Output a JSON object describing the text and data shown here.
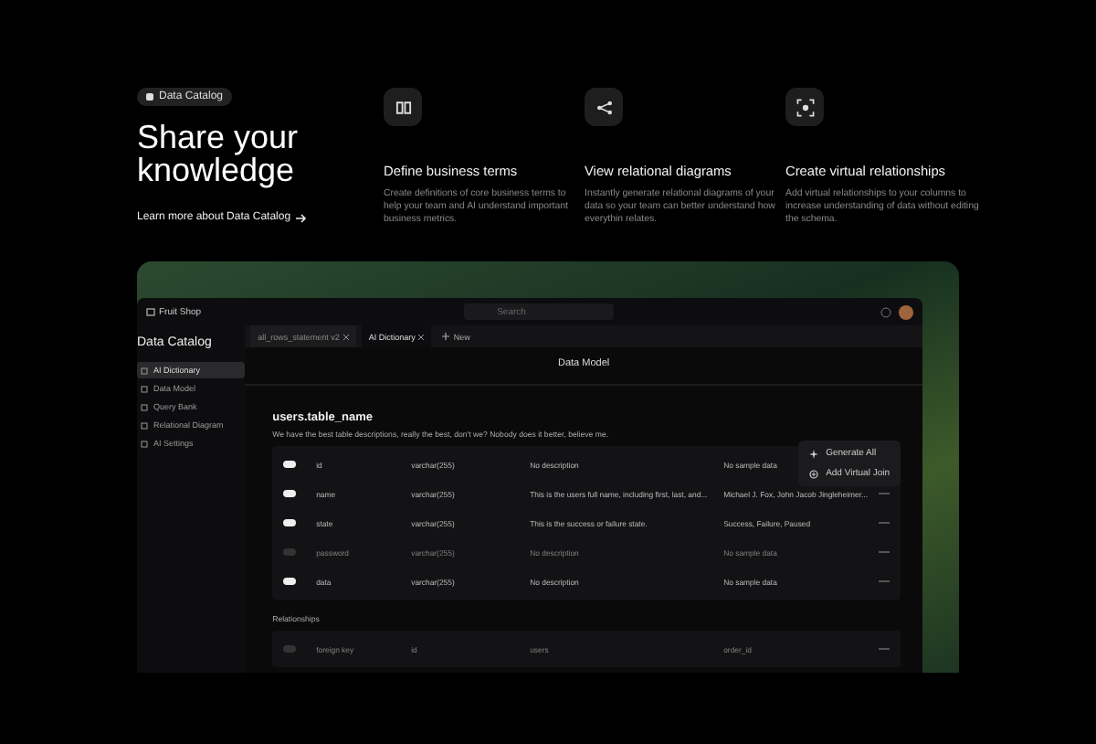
{
  "badge": "Data Catalog",
  "headline": "Share your knowledge",
  "learn_link": "Learn more about Data Catalog",
  "features": [
    {
      "kind": "book",
      "title": "Define business terms",
      "text": "Create definitions of core business terms to help your team and AI understand important business metrics."
    },
    {
      "kind": "share",
      "title": "View relational diagrams",
      "text": "Instantly generate relational diagrams of your data so your team can better understand how everythin relates."
    },
    {
      "kind": "scan",
      "title": "Create virtual relationships",
      "text": "Add virtual relationships to your columns to increase understanding of data without editing the schema."
    }
  ],
  "app": {
    "workspace": "Fruit Shop",
    "search": {
      "placeholder": "Search"
    },
    "sidebar_title": "Data Catalog",
    "sidebar": [
      {
        "label": "AI Dictionary",
        "selected": true
      },
      {
        "label": "Data Model",
        "selected": false
      },
      {
        "label": "Query Bank",
        "selected": false
      },
      {
        "label": "Relational Diagram",
        "selected": false
      },
      {
        "label": "AI Settings",
        "selected": false
      }
    ],
    "tabs": [
      {
        "label": "all_rows_statement v2",
        "selected": false
      },
      {
        "label": "AI Dictionary",
        "selected": true
      }
    ],
    "new_tab": "New",
    "page_title": "Data Model",
    "table_name": "users.table_name",
    "table_description": "We have the best table descriptions, really the best, don't we? Nobody does it better, believe me.",
    "columns": [
      {
        "name": "id",
        "type": "varchar(255)",
        "description": "No description",
        "sample": "No sample data",
        "on": true
      },
      {
        "name": "name",
        "type": "varchar(255)",
        "description": "This is the users full name, including first, last, and...",
        "sample": "Michael J. Fox, John Jacob Jingleheimer...",
        "on": true
      },
      {
        "name": "state",
        "type": "varchar(255)",
        "description": "This is the success or failure state.",
        "sample": "Success, Failure, Paused",
        "on": true
      },
      {
        "name": "password",
        "type": "varchar(255)",
        "description": "No description",
        "sample": "No sample data",
        "on": false
      },
      {
        "name": "data",
        "type": "varchar(255)",
        "description": "No description",
        "sample": "No sample data",
        "on": true
      }
    ],
    "relationships_label": "Relationships",
    "relationships": [
      {
        "name": "foreign key",
        "type": "id",
        "description": "users",
        "sample": "order_id",
        "on": false
      }
    ],
    "menu": [
      {
        "kind": "generate",
        "label": "Generate All"
      },
      {
        "kind": "join",
        "label": "Add Virtual Join"
      }
    ]
  }
}
